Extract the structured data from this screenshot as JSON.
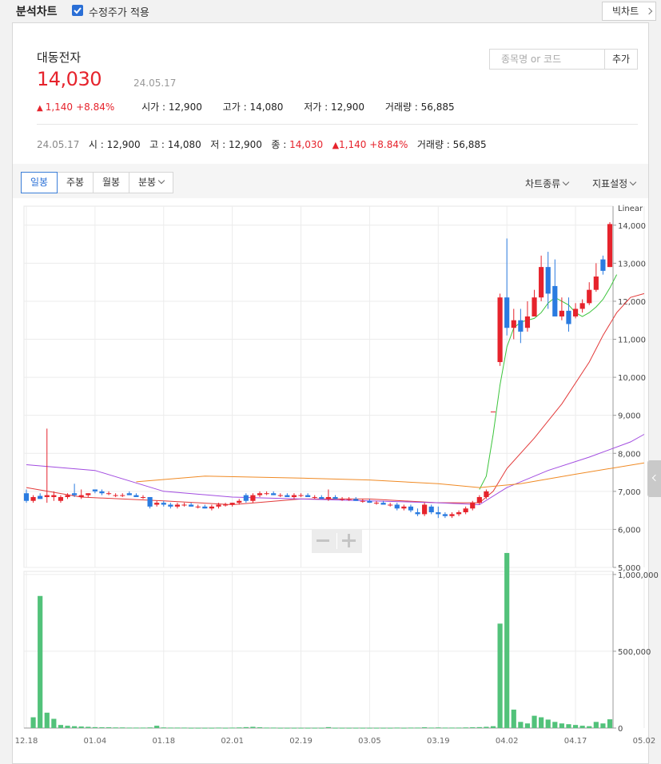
{
  "topbar": {
    "title": "분석차트",
    "adjusted_label": "수정주가 적용",
    "adjusted_checked": true,
    "big_chart_label": "빅차트"
  },
  "stock": {
    "name": "대동전자",
    "price": "14,030",
    "date": "24.05.17",
    "change": "1,140",
    "change_pct": "+8.84%",
    "open_label": "시가 : ",
    "open": "12,900",
    "high_label": "고가 : ",
    "high": "14,080",
    "low_label": "저가 : ",
    "low": "12,900",
    "volume_label": "거래량 : ",
    "volume": "56,885"
  },
  "search": {
    "placeholder": "종목명 or 코드",
    "add_label": "추가"
  },
  "summary": {
    "date": "24.05.17",
    "open_label": "시 : ",
    "open": "12,900",
    "high_label": "고 : ",
    "high": "14,080",
    "low_label": "저 : ",
    "low": "12,900",
    "close_label": "종 : ",
    "close": "14,030",
    "change": "1,140",
    "change_pct": "+8.84%",
    "volume_label": "거래량 : ",
    "volume": "56,885"
  },
  "toolbar": {
    "periods": [
      "일봉",
      "주봉",
      "월봉",
      "분봉"
    ],
    "active_period": "일봉",
    "chart_type_label": "차트종류",
    "indicator_label": "지표설정"
  },
  "colors": {
    "up": "#e6232c",
    "down": "#2a7be0",
    "accent": "#2a6fd6",
    "volume": "#52c27a",
    "ma5": "#3cc43c",
    "ma20": "#e33a3a",
    "ma60": "#a24ce0",
    "ma120": "#f08a24"
  },
  "chart_data": {
    "type": "candlestick",
    "scale_label": "Linear",
    "price_ticks": [
      "14,000",
      "13,000",
      "12,000",
      "11,000",
      "10,000",
      "9,000",
      "8,000",
      "7,000",
      "6,000",
      "5,000"
    ],
    "price_tick_values": [
      14000,
      13000,
      12000,
      11000,
      10000,
      9000,
      8000,
      7000,
      6000,
      5000
    ],
    "price_range": [
      5000,
      14500
    ],
    "volume_ticks": [
      "1,000,000",
      "500,000",
      "0"
    ],
    "volume_tick_values": [
      1000000,
      500000,
      0
    ],
    "volume_range": [
      0,
      1020000
    ],
    "x_labels": [
      "12.18",
      "01.04",
      "01.18",
      "02.01",
      "02.19",
      "03.05",
      "03.19",
      "04.02",
      "04.17",
      "05.02"
    ],
    "x_label_indices": [
      0,
      10,
      20,
      30,
      40,
      50,
      60,
      70,
      80,
      90
    ],
    "candles": [
      [
        6950,
        7050,
        6700,
        6750,
        0
      ],
      [
        6750,
        6900,
        6700,
        6850,
        70000
      ],
      [
        6880,
        6950,
        6800,
        6800,
        860000
      ],
      [
        6850,
        8650,
        6700,
        6900,
        100000
      ],
      [
        6850,
        7000,
        6750,
        6900,
        60000
      ],
      [
        6750,
        6900,
        6700,
        6850,
        20000
      ],
      [
        6850,
        6950,
        6800,
        6900,
        15000
      ],
      [
        6950,
        7200,
        6850,
        6900,
        12000
      ],
      [
        6850,
        7050,
        6800,
        6900,
        10000
      ],
      [
        6900,
        6950,
        6850,
        6950,
        8000
      ],
      [
        7050,
        7050,
        6950,
        7000,
        6000
      ],
      [
        7000,
        7050,
        6900,
        6950,
        5000
      ],
      [
        6950,
        7000,
        6900,
        6950,
        5000
      ],
      [
        6900,
        6950,
        6850,
        6900,
        4000
      ],
      [
        6900,
        6950,
        6850,
        6900,
        4000
      ],
      [
        6950,
        7000,
        6900,
        6900,
        3000
      ],
      [
        6900,
        6950,
        6850,
        6850,
        3000
      ],
      [
        6850,
        6900,
        6800,
        6850,
        3000
      ],
      [
        6850,
        6850,
        6550,
        6600,
        4000
      ],
      [
        6650,
        6750,
        6600,
        6700,
        15000
      ],
      [
        6700,
        6750,
        6600,
        6650,
        4000
      ],
      [
        6650,
        6700,
        6550,
        6600,
        3000
      ],
      [
        6600,
        6700,
        6550,
        6650,
        3000
      ],
      [
        6650,
        6700,
        6600,
        6650,
        3000
      ],
      [
        6650,
        6700,
        6600,
        6600,
        2000
      ],
      [
        6600,
        6650,
        6550,
        6600,
        2000
      ],
      [
        6600,
        6650,
        6550,
        6550,
        2000
      ],
      [
        6550,
        6650,
        6500,
        6600,
        2000
      ],
      [
        6600,
        6700,
        6550,
        6650,
        3000
      ],
      [
        6650,
        6700,
        6600,
        6650,
        2000
      ],
      [
        6650,
        6700,
        6600,
        6700,
        3000
      ],
      [
        6700,
        6800,
        6650,
        6750,
        4000
      ],
      [
        6900,
        6950,
        6700,
        6750,
        6000
      ],
      [
        6750,
        6950,
        6700,
        6900,
        8000
      ],
      [
        6900,
        7000,
        6850,
        6950,
        5000
      ],
      [
        6950,
        7000,
        6900,
        6950,
        3000
      ],
      [
        6950,
        7000,
        6900,
        6900,
        3000
      ],
      [
        6900,
        6950,
        6850,
        6900,
        2000
      ],
      [
        6900,
        6950,
        6850,
        6850,
        2000
      ],
      [
        6850,
        6950,
        6800,
        6900,
        2000
      ],
      [
        6900,
        6950,
        6850,
        6900,
        2000
      ],
      [
        6900,
        6950,
        6850,
        6850,
        2000
      ],
      [
        6850,
        6900,
        6800,
        6850,
        2000
      ],
      [
        6850,
        6900,
        6800,
        6800,
        2000
      ],
      [
        6800,
        7050,
        6750,
        6850,
        6000
      ],
      [
        6850,
        6900,
        6800,
        6800,
        2000
      ],
      [
        6800,
        6850,
        6750,
        6800,
        2000
      ],
      [
        6800,
        6850,
        6750,
        6800,
        2000
      ],
      [
        6800,
        6850,
        6750,
        6750,
        2000
      ],
      [
        6750,
        6800,
        6700,
        6750,
        2000
      ],
      [
        6750,
        6800,
        6700,
        6700,
        2000
      ],
      [
        6700,
        6750,
        6650,
        6700,
        2000
      ],
      [
        6700,
        6750,
        6650,
        6650,
        2000
      ],
      [
        6650,
        6700,
        6600,
        6650,
        2000
      ],
      [
        6650,
        6700,
        6500,
        6550,
        3000
      ],
      [
        6550,
        6650,
        6500,
        6600,
        2000
      ],
      [
        6600,
        6650,
        6450,
        6500,
        3000
      ],
      [
        6450,
        6550,
        6350,
        6400,
        3000
      ],
      [
        6400,
        6700,
        6350,
        6650,
        5000
      ],
      [
        6600,
        6650,
        6400,
        6450,
        3000
      ],
      [
        6450,
        6600,
        6300,
        6400,
        4000
      ],
      [
        6400,
        6450,
        6300,
        6350,
        3000
      ],
      [
        6350,
        6450,
        6300,
        6400,
        3000
      ],
      [
        6400,
        6500,
        6350,
        6450,
        3000
      ],
      [
        6450,
        6600,
        6400,
        6550,
        4000
      ],
      [
        6550,
        6750,
        6500,
        6700,
        5000
      ],
      [
        6700,
        6900,
        6650,
        6850,
        6000
      ],
      [
        6850,
        7050,
        6800,
        7000,
        8000
      ],
      [
        9100,
        9100,
        9100,
        9100,
        12000
      ],
      [
        10400,
        12200,
        10300,
        12100,
        680000
      ],
      [
        12100,
        13650,
        11100,
        11300,
        1140000
      ],
      [
        11300,
        11800,
        11000,
        11500,
        120000
      ],
      [
        11500,
        11800,
        10900,
        11200,
        40000
      ],
      [
        11300,
        12000,
        11200,
        11600,
        30000
      ],
      [
        11600,
        12300,
        11600,
        12100,
        80000
      ],
      [
        12100,
        13200,
        12000,
        12900,
        70000
      ],
      [
        12900,
        13300,
        11800,
        12200,
        55000
      ],
      [
        12400,
        13100,
        11600,
        11600,
        40000
      ],
      [
        11600,
        12100,
        11500,
        11750,
        30000
      ],
      [
        11750,
        12100,
        11200,
        11400,
        25000
      ],
      [
        11600,
        11950,
        11550,
        11800,
        20000
      ],
      [
        11800,
        12050,
        11700,
        11950,
        15000
      ],
      [
        11950,
        12500,
        11900,
        12300,
        12000
      ],
      [
        12300,
        13000,
        12250,
        12650,
        40000
      ],
      [
        13100,
        13200,
        12700,
        12800,
        30000
      ],
      [
        12900,
        14080,
        12900,
        14030,
        56885
      ]
    ],
    "ma": [
      {
        "label": "5",
        "color": "#3cc43c",
        "points": [
          [
            66,
            7050
          ],
          [
            67,
            7400
          ],
          [
            68,
            8500
          ],
          [
            69,
            9800
          ],
          [
            70,
            10800
          ],
          [
            71,
            11300
          ],
          [
            72,
            11450
          ],
          [
            73,
            11500
          ],
          [
            74,
            11550
          ],
          [
            75,
            11700
          ],
          [
            76,
            11950
          ],
          [
            77,
            12100
          ],
          [
            78,
            12000
          ],
          [
            79,
            11900
          ],
          [
            80,
            11700
          ],
          [
            81,
            11600
          ],
          [
            82,
            11700
          ],
          [
            83,
            11850
          ],
          [
            84,
            12050
          ],
          [
            85,
            12350
          ],
          [
            86,
            12700
          ]
        ]
      },
      {
        "label": "20",
        "color": "#e33a3a",
        "points": [
          [
            0,
            7100
          ],
          [
            8,
            6850
          ],
          [
            20,
            6750
          ],
          [
            30,
            6650
          ],
          [
            40,
            6800
          ],
          [
            50,
            6800
          ],
          [
            60,
            6700
          ],
          [
            66,
            6700
          ],
          [
            68,
            7000
          ],
          [
            70,
            7600
          ],
          [
            74,
            8400
          ],
          [
            78,
            9300
          ],
          [
            82,
            10400
          ],
          [
            84,
            11100
          ],
          [
            86,
            11700
          ],
          [
            88,
            12100
          ],
          [
            90,
            12200
          ]
        ]
      },
      {
        "label": "60",
        "color": "#a24ce0",
        "points": [
          [
            0,
            7700
          ],
          [
            10,
            7550
          ],
          [
            20,
            7000
          ],
          [
            30,
            6850
          ],
          [
            40,
            6800
          ],
          [
            50,
            6750
          ],
          [
            60,
            6700
          ],
          [
            66,
            6650
          ],
          [
            70,
            7100
          ],
          [
            76,
            7550
          ],
          [
            82,
            7900
          ],
          [
            88,
            8300
          ],
          [
            90,
            8500
          ]
        ]
      },
      {
        "label": "120",
        "color": "#f08a24",
        "points": [
          [
            16,
            7250
          ],
          [
            26,
            7400
          ],
          [
            40,
            7350
          ],
          [
            50,
            7300
          ],
          [
            60,
            7200
          ],
          [
            66,
            7100
          ],
          [
            72,
            7200
          ],
          [
            80,
            7450
          ],
          [
            90,
            7750
          ]
        ]
      }
    ]
  }
}
